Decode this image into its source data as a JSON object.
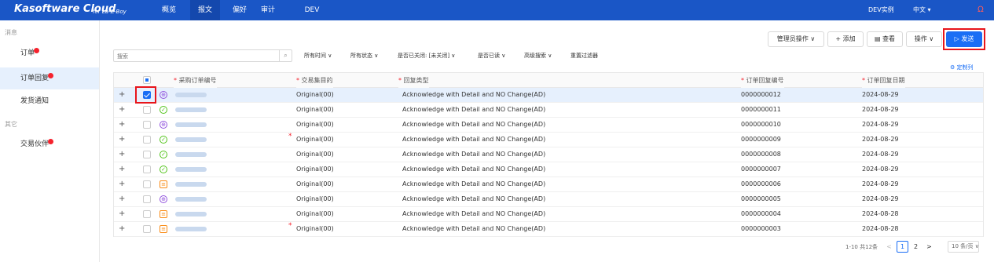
{
  "app": {
    "name": "Kasoftware Cloud",
    "sub": "for La-Z-Boy"
  },
  "nav": [
    "概览",
    "报文",
    "偏好",
    "审计",
    "DEV"
  ],
  "topright": {
    "instance": "DEV实例",
    "lang": "中文"
  },
  "sidebar": {
    "sec1": "消息",
    "sec2": "其它",
    "items": [
      "订单",
      "订单回复",
      "发货通知",
      "交易伙伴"
    ]
  },
  "toolbar": {
    "admin": "管理员操作",
    "add": "+ 添加",
    "view": "查看",
    "ops": "操作",
    "send": "发送"
  },
  "search": {
    "placeholder": "搜索"
  },
  "filters": [
    "所有时间",
    "所有状态",
    "是否已关闭: [未关闭]",
    "是否已读",
    "高级搜索",
    "重置过滤器"
  ],
  "custom_cols": "定制列",
  "columns": [
    "采购订单编号",
    "交易集目的",
    "回复类型",
    "订单回复编号",
    "订单回复日期"
  ],
  "rows": [
    {
      "purpose": "Original(00)",
      "type": "Acknowledge with Detail and NO Change(AD)",
      "no": "0000000012",
      "date": "2024-08-29",
      "status": "circ",
      "sel": true
    },
    {
      "purpose": "Original(00)",
      "type": "Acknowledge with Detail and NO Change(AD)",
      "no": "0000000011",
      "date": "2024-08-29",
      "status": "chk",
      "sel": false
    },
    {
      "purpose": "Original(00)",
      "type": "Acknowledge with Detail and NO Change(AD)",
      "no": "0000000010",
      "date": "2024-08-29",
      "status": "circ",
      "sel": false
    },
    {
      "purpose": "Original(00)",
      "type": "Acknowledge with Detail and NO Change(AD)",
      "no": "0000000009",
      "date": "2024-08-29",
      "status": "chk",
      "sel": false
    },
    {
      "purpose": "Original(00)",
      "type": "Acknowledge with Detail and NO Change(AD)",
      "no": "0000000008",
      "date": "2024-08-29",
      "status": "chk",
      "sel": false
    },
    {
      "purpose": "Original(00)",
      "type": "Acknowledge with Detail and NO Change(AD)",
      "no": "0000000007",
      "date": "2024-08-29",
      "status": "chk",
      "sel": false
    },
    {
      "purpose": "Original(00)",
      "type": "Acknowledge with Detail and NO Change(AD)",
      "no": "0000000006",
      "date": "2024-08-29",
      "status": "doc",
      "sel": false
    },
    {
      "purpose": "Original(00)",
      "type": "Acknowledge with Detail and NO Change(AD)",
      "no": "0000000005",
      "date": "2024-08-29",
      "status": "circ",
      "sel": false
    },
    {
      "purpose": "Original(00)",
      "type": "Acknowledge with Detail and NO Change(AD)",
      "no": "0000000004",
      "date": "2024-08-28",
      "status": "doc",
      "sel": false
    },
    {
      "purpose": "Original(00)",
      "type": "Acknowledge with Detail and NO Change(AD)",
      "no": "0000000003",
      "date": "2024-08-28",
      "status": "doc",
      "sel": false
    }
  ],
  "pager": {
    "summary": "1-10 共12条",
    "page1": "1",
    "page2": "2",
    "size": "10 条/页"
  },
  "colors": {
    "brand": "#1a56c6",
    "primary": "#1a6ef5",
    "highlight": "#e8151b"
  }
}
